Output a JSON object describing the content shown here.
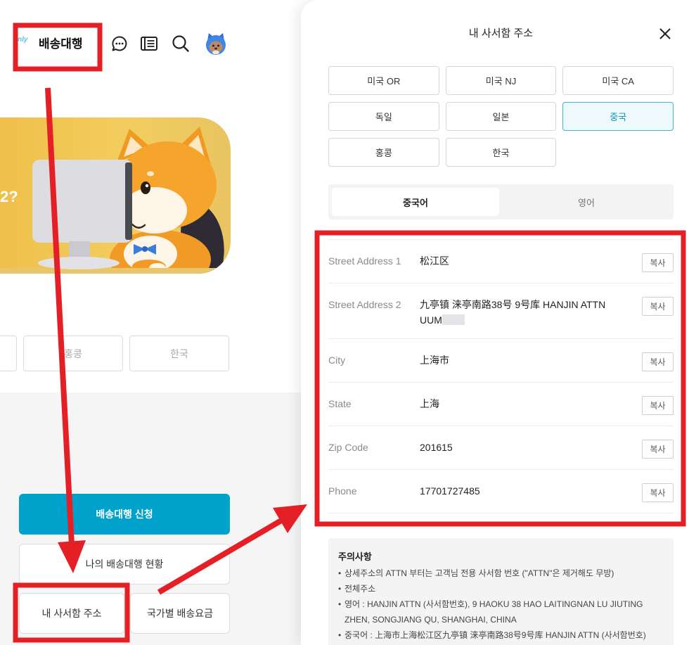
{
  "header": {
    "badge": "nly",
    "title": "배송대행",
    "icons": {
      "chat": "chat-icon",
      "news": "news-icon",
      "search": "search-icon",
      "profile": "avatar"
    }
  },
  "banner": {
    "text": "2?"
  },
  "country_row": [
    {
      "label": "홍콩"
    },
    {
      "label": "한국"
    }
  ],
  "actions": {
    "apply": "배송대행 신청",
    "status": "나의 배송대행 현황",
    "mailbox": "내 사서함 주소",
    "rates": "국가별 배송요금"
  },
  "panel": {
    "title": "내 사서함 주소",
    "close_icon": "close-icon",
    "countries": [
      {
        "label": "미국 OR",
        "selected": false
      },
      {
        "label": "미국 NJ",
        "selected": false
      },
      {
        "label": "미국 CA",
        "selected": false
      },
      {
        "label": "독일",
        "selected": false
      },
      {
        "label": "일본",
        "selected": false
      },
      {
        "label": "중국",
        "selected": true
      },
      {
        "label": "홍콩",
        "selected": false
      },
      {
        "label": "한국",
        "selected": false
      }
    ],
    "tabs": [
      {
        "label": "중국어",
        "active": true
      },
      {
        "label": "영어",
        "active": false
      }
    ],
    "copy_label": "복사",
    "address_rows": [
      {
        "label": "Street Address 1",
        "value": "松江区"
      },
      {
        "label": "Street Address 2",
        "value": "九亭镇 涞亭南路38号 9号库 HANJIN ATTN UUM"
      },
      {
        "label": "City",
        "value": "上海市"
      },
      {
        "label": "State",
        "value": "上海"
      },
      {
        "label": "Zip Code",
        "value": "201615"
      },
      {
        "label": "Phone",
        "value": "17701727485"
      }
    ],
    "notice": {
      "title": "주의사항",
      "items": [
        "상세주소의 ATTN 부터는 고객님 전용 사서함 번호 (\"ATTN\"은 제거해도 무방)",
        "전체주소",
        "영어 : HANJIN ATTN (사서함번호), 9 HAOKU 38 HAO LAITINGNAN LU JIUTING ZHEN, SONGJIANG QU, SHANGHAI, CHINA",
        "중국어 : 上海市上海松江区九亭镇 涞亭南路38号9号库 HANJIN ATTN (사서함번호)"
      ]
    }
  },
  "colors": {
    "accent": "#00a2cb",
    "selected_border": "#3fb3cc",
    "selected_bg": "#eef9fb",
    "selected_text": "#0a97b7",
    "annotation": "#e41f26",
    "banner": "#efc452"
  }
}
